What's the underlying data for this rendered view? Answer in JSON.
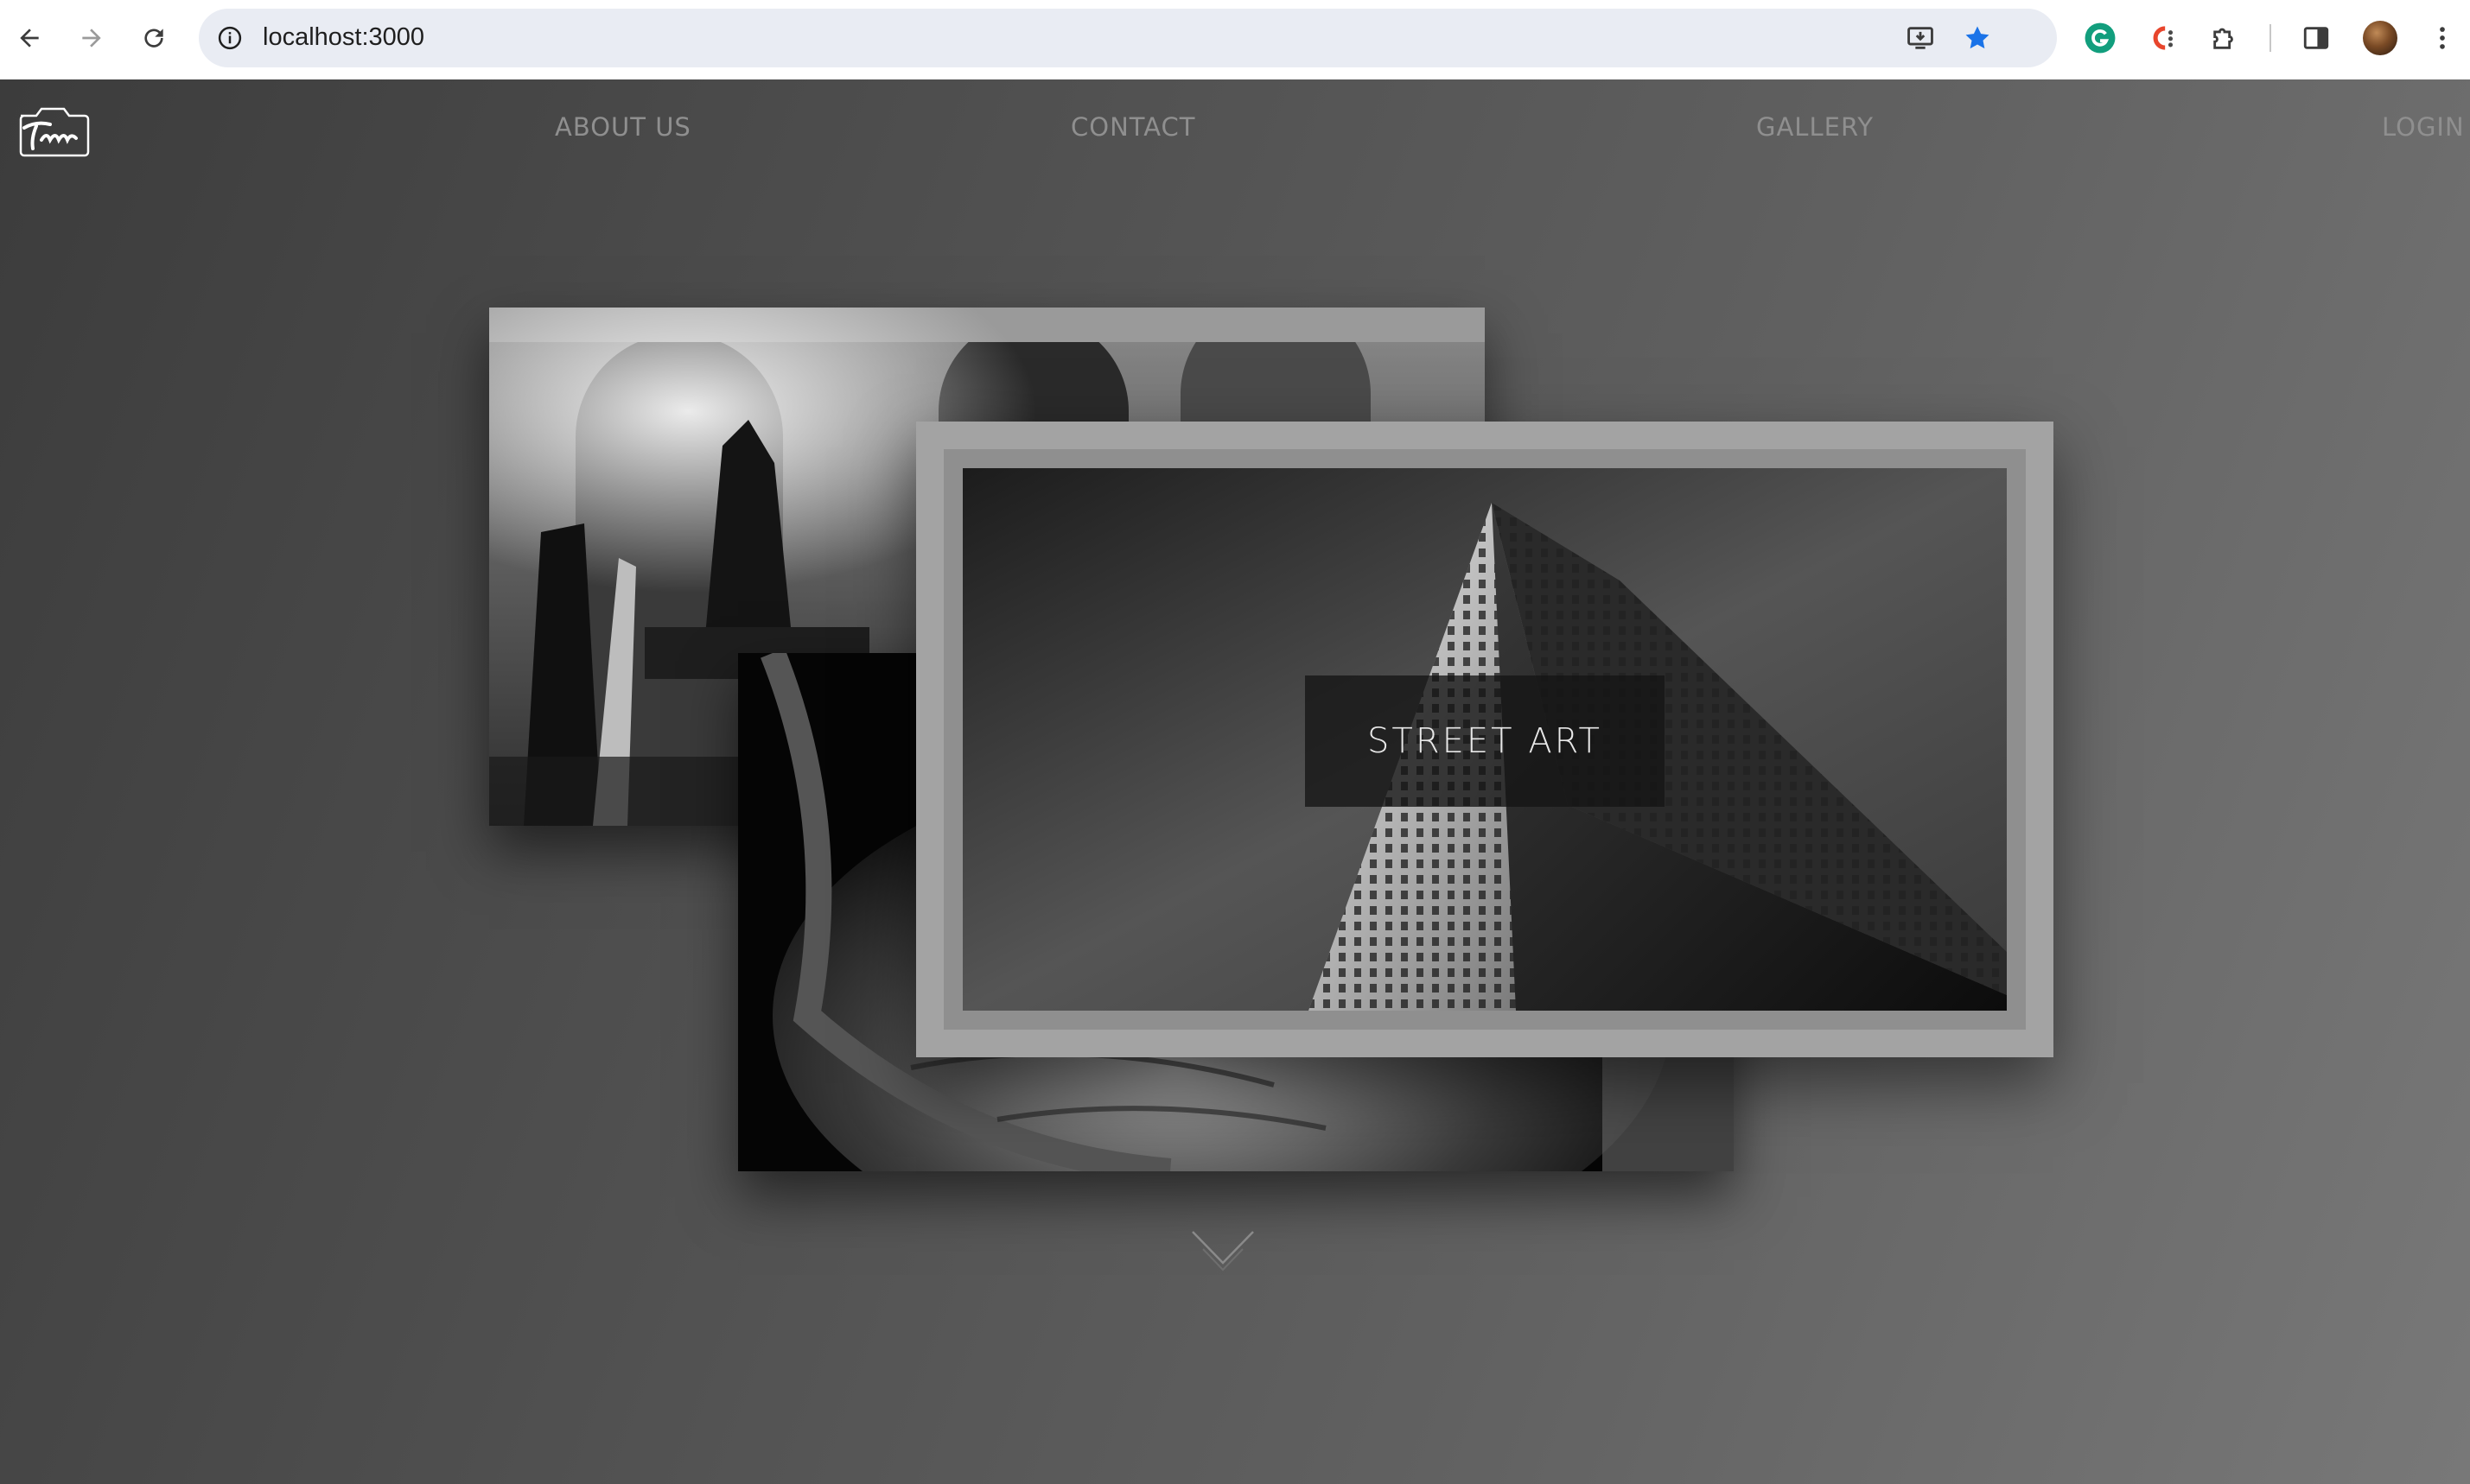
{
  "browser": {
    "url": "localhost:3000",
    "icons": [
      "back-icon",
      "forward-icon",
      "reload-icon",
      "site-info-icon",
      "install-app-icon",
      "bookmark-star-icon",
      "grammarly-extension-icon",
      "color-picker-extension-icon",
      "extensions-puzzle-icon",
      "side-panel-icon",
      "profile-avatar",
      "more-menu-icon"
    ],
    "star_color": "#1a73e8"
  },
  "site": {
    "logo_text": "Thom",
    "nav": {
      "about": "ABOUT US",
      "contact": "CONTACT",
      "gallery": "GALLERY",
      "login": "LOGIN"
    },
    "featured_caption": "STREET ART",
    "scroll_icon": "chevron-down-icon"
  }
}
